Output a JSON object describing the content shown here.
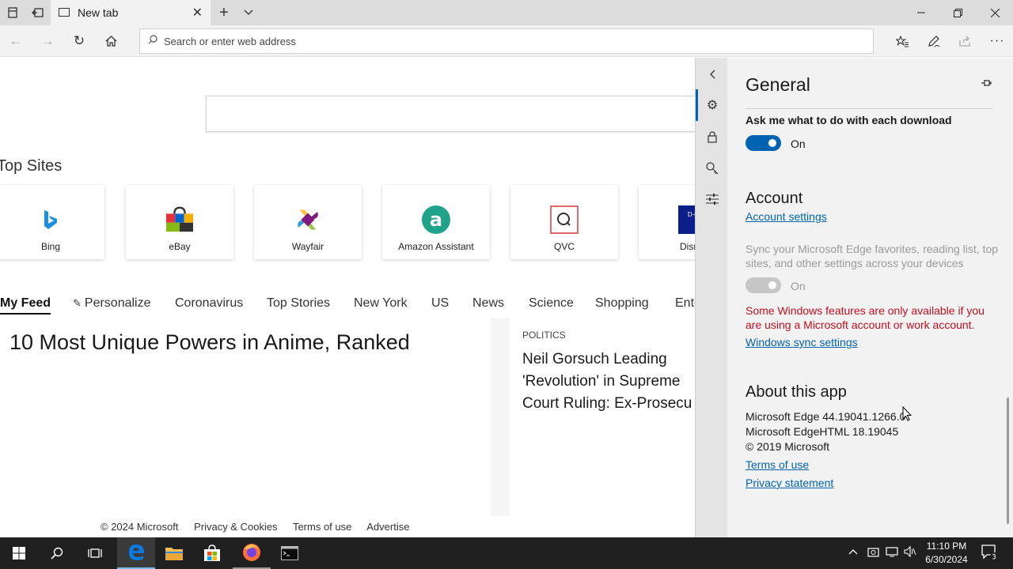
{
  "browser": {
    "tab_title": "New tab",
    "address_placeholder": "Search or enter web address"
  },
  "newtab": {
    "top_sites_title": "Top Sites",
    "top_sites": [
      {
        "label": "Bing",
        "icon": "bing-logo"
      },
      {
        "label": "eBay",
        "icon": "ebay-bag-logo"
      },
      {
        "label": "Wayfair",
        "icon": "wayfair-pinwheel-logo"
      },
      {
        "label": "Amazon Assistant",
        "icon": "amazon-assistant-logo"
      },
      {
        "label": "QVC",
        "icon": "qvc-logo"
      },
      {
        "label": "Disn",
        "icon": "disney-logo"
      }
    ],
    "feed_tabs": [
      "My Feed",
      "Personalize",
      "Coronavirus",
      "Top Stories",
      "New York",
      "US",
      "News",
      "Science",
      "Shopping",
      "Ente"
    ],
    "active_feed_tab": "My Feed",
    "articles": [
      {
        "headline": "10 Most Unique Powers in Anime, Ranked"
      },
      {
        "category": "POLITICS",
        "headline": "Neil Gorsuch Leading 'Revolution' in Supreme Court Ruling: Ex-Prosecu"
      }
    ],
    "footer": [
      "© 2024 Microsoft",
      "Privacy & Cookies",
      "Terms of use",
      "Advertise"
    ]
  },
  "settings": {
    "title": "General",
    "download_question": "Ask me what to do with each download",
    "download_toggle": "On",
    "account_heading": "Account",
    "account_settings_link": "Account settings",
    "sync_text": "Sync your Microsoft Edge favorites, reading list, top sites, and other settings across your devices",
    "sync_toggle": "On",
    "warning_text": "Some Windows features are only available if you are using a Microsoft account or work account.",
    "sync_settings_link": "Windows sync settings",
    "about_heading": "About this app",
    "version_edge": "Microsoft Edge 44.19041.1266.0",
    "version_html": "Microsoft EdgeHTML 18.19045",
    "copyright": "© 2019 Microsoft",
    "terms_link": "Terms of use",
    "privacy_link": "Privacy statement"
  },
  "taskbar": {
    "time": "11:10 PM",
    "date": "6/30/2024",
    "notification_count": "3"
  },
  "colors": {
    "accent": "#0063b1",
    "warning": "#c50f1f",
    "taskbar": "#202020"
  }
}
